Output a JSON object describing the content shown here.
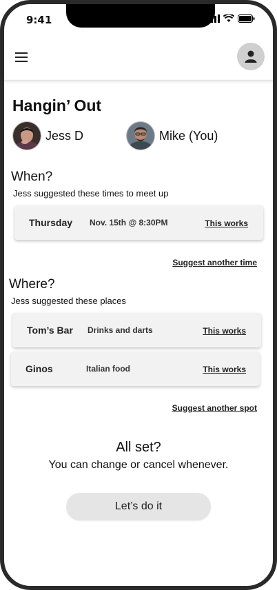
{
  "status_bar": {
    "time": "9:41"
  },
  "page": {
    "title": "Hangin’ Out"
  },
  "people": [
    {
      "name": "Jess D"
    },
    {
      "name": "Mike (You)"
    }
  ],
  "when": {
    "heading": "When?",
    "subtitle": "Jess suggested these times to meet up",
    "options": [
      {
        "day": "Thursday",
        "datetime": "Nov. 15th @ 8:30PM",
        "action": "This works"
      }
    ],
    "suggest_link": "Suggest another time"
  },
  "where": {
    "heading": "Where?",
    "subtitle": "Jess suggested these places",
    "options": [
      {
        "place": "Tom’s Bar",
        "description": "Drinks and darts",
        "action": "This works"
      },
      {
        "place": "Ginos",
        "description": "Italian food",
        "action": "This works"
      }
    ],
    "suggest_link": "Suggest another spot"
  },
  "confirm": {
    "title": "All set?",
    "subtitle": "You can change or cancel whenever.",
    "button": "Let’s do it"
  },
  "icons": {
    "menu": "hamburger-menu-icon",
    "profile": "user-profile-icon"
  }
}
